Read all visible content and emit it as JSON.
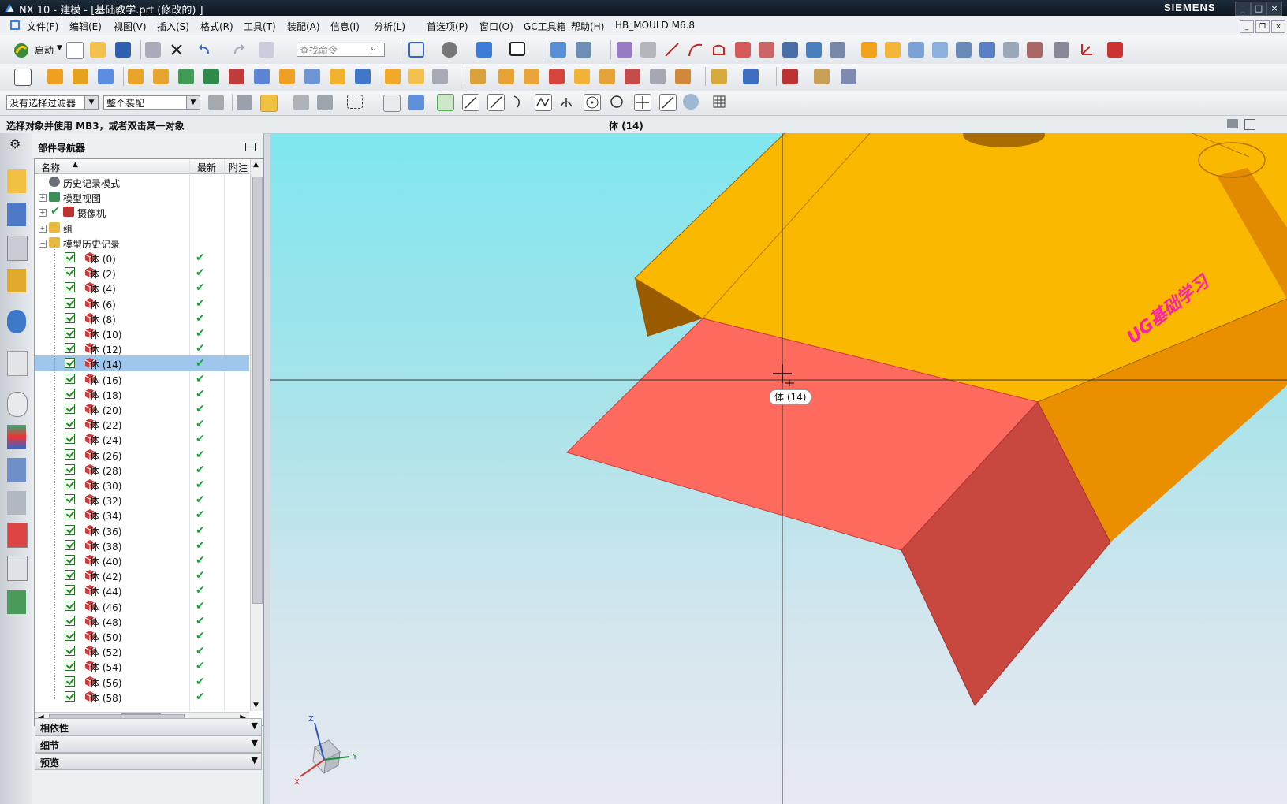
{
  "window": {
    "title": "NX 10 - 建模 - [基础教学.prt  (修改的)  ]",
    "brand": "SIEMENS",
    "controls": [
      "_",
      "□",
      "×"
    ]
  },
  "menu": [
    "文件(F)",
    "编辑(E)",
    "视图(V)",
    "插入(S)",
    "格式(R)",
    "工具(T)",
    "装配(A)",
    "信息(I)",
    "分析(L)",
    "首选项(P)",
    "窗口(O)",
    "GC工具箱",
    "帮助(H)",
    "HB_MOULD M6.8"
  ],
  "toolbar": {
    "start_label": "启动",
    "search_placeholder": "查找命令"
  },
  "filters": {
    "selection_filter": "没有选择过滤器",
    "scope": "整个装配"
  },
  "status": {
    "prompt": "选择对象并使用 MB3，或者双击某一对象",
    "selection": "体 (14)"
  },
  "navigator": {
    "title": "部件导航器",
    "columns": {
      "name": "名称",
      "latest": "最新",
      "note": "附注"
    },
    "top_rows": [
      {
        "label": "历史记录模式"
      },
      {
        "label": "模型视图"
      },
      {
        "label": "摄像机"
      },
      {
        "label": "组"
      },
      {
        "label": "模型历史记录"
      }
    ],
    "bodies": [
      "体 (0)",
      "体 (2)",
      "体 (4)",
      "体 (6)",
      "体 (8)",
      "体 (10)",
      "体 (12)",
      "体 (14)",
      "体 (16)",
      "体 (18)",
      "体 (20)",
      "体 (22)",
      "体 (24)",
      "体 (26)",
      "体 (28)",
      "体 (30)",
      "体 (32)",
      "体 (34)",
      "体 (36)",
      "体 (38)",
      "体 (40)",
      "体 (42)",
      "体 (44)",
      "体 (46)",
      "体 (48)",
      "体 (50)",
      "体 (52)",
      "体 (54)",
      "体 (56)",
      "体 (58)"
    ],
    "selected_body": "体 (14)",
    "latest_mark": "✔",
    "sections": [
      "相依性",
      "细节",
      "预览"
    ]
  },
  "viewport": {
    "tooltip": "体 (14)",
    "watermark": "UG基础学习",
    "axes": {
      "z": "Z",
      "y": "Y",
      "x": "X"
    }
  },
  "colors": {
    "body_top": "#fbb800",
    "body_side": "#e98f00",
    "selected_face": "#ff6a5e",
    "selected_side": "#c8473f",
    "watermark": "#ff1fa8",
    "tree_selection": "#9fc7ee"
  }
}
